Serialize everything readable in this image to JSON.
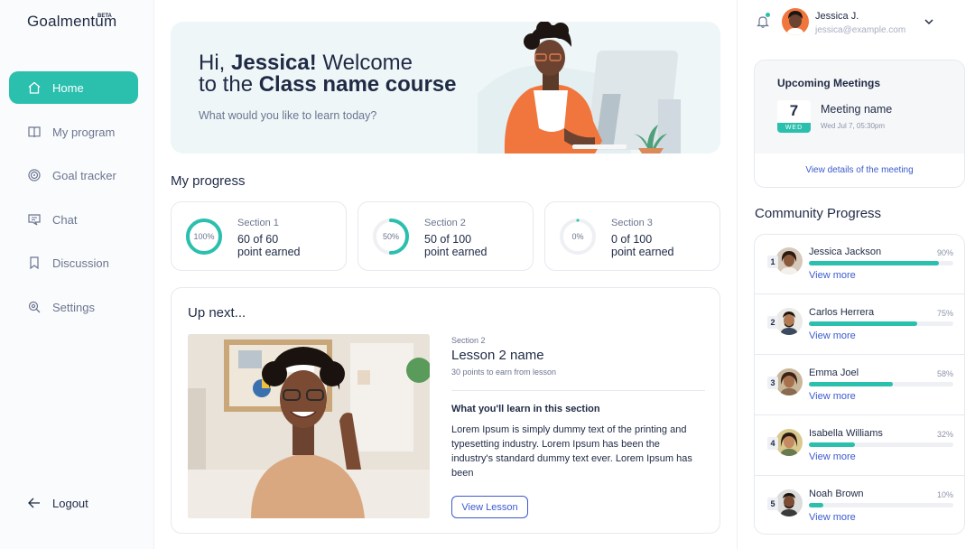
{
  "brand": {
    "logo": "Goalmentum",
    "beta": "BETA",
    "accent": "#2bbfae",
    "link_color": "#3c5bcf"
  },
  "sidebar": {
    "items": [
      {
        "label": "Home",
        "icon": "home-icon",
        "active": true
      },
      {
        "label": "My program",
        "icon": "book-icon",
        "active": false
      },
      {
        "label": "Goal tracker",
        "icon": "target-icon",
        "active": false
      },
      {
        "label": "Chat",
        "icon": "chat-icon",
        "active": false
      },
      {
        "label": "Discussion",
        "icon": "bookmark-icon",
        "active": false
      },
      {
        "label": "Settings",
        "icon": "gear-icon",
        "active": false
      }
    ],
    "logout": {
      "label": "Logout",
      "icon": "logout-icon"
    }
  },
  "banner": {
    "greeting": "Hi, ",
    "name": "Jessica!",
    "welcome": " Welcome",
    "line2_prefix": "to the ",
    "course": "Class name course",
    "subtitle": "What would you like to learn today?"
  },
  "progress": {
    "title": "My progress",
    "sections": [
      {
        "label": "Section 1",
        "percent": "100%",
        "fraction": 1.0,
        "points": "60 of 60",
        "earned": "point earned"
      },
      {
        "label": "Section 2",
        "percent": "50%",
        "fraction": 0.5,
        "points": "50 of 100",
        "earned": "point earned"
      },
      {
        "label": "Section 3",
        "percent": "0%",
        "fraction": 0.0,
        "points": "0 of 100",
        "earned": "point earned"
      }
    ]
  },
  "upnext": {
    "title": "Up next...",
    "section": "Section 2",
    "lesson": "Lesson 2 name",
    "points": "30 points to earn from lesson",
    "learn_title": "What you'll learn in this section",
    "description": "Lorem Ipsum is simply dummy text of the printing and typesetting industry. Lorem Ipsum has been the industry's standard dummy text ever.  Lorem Ipsum has been",
    "button": "View Lesson"
  },
  "user": {
    "name": "Jessica J.",
    "email": "jessica@example.com"
  },
  "meetings": {
    "title": "Upcoming Meetings",
    "day_num": "7",
    "day_name": "WED",
    "name": "Meeting name",
    "time": "Wed Jul 7, 05:30pm",
    "link": "View details of the meeting"
  },
  "community": {
    "title": "Community Progress",
    "members": [
      {
        "rank": "1",
        "name": "Jessica Jackson",
        "percent": "90%",
        "fraction": 0.9,
        "link": "View more"
      },
      {
        "rank": "2",
        "name": "Carlos Herrera",
        "percent": "75%",
        "fraction": 0.75,
        "link": "View more"
      },
      {
        "rank": "3",
        "name": "Emma Joel",
        "percent": "58%",
        "fraction": 0.58,
        "link": "View more"
      },
      {
        "rank": "4",
        "name": "Isabella Williams",
        "percent": "32%",
        "fraction": 0.32,
        "link": "View more"
      },
      {
        "rank": "5",
        "name": "Noah Brown",
        "percent": "10%",
        "fraction": 0.1,
        "link": "View more"
      }
    ]
  }
}
